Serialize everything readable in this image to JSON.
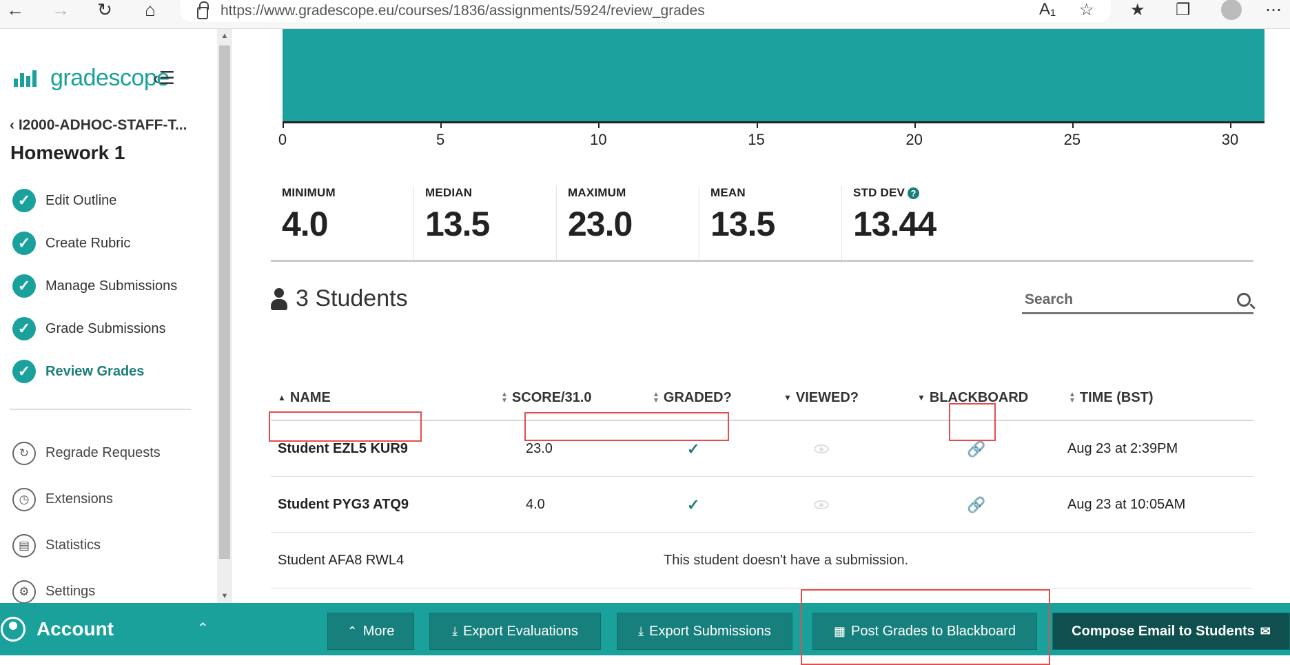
{
  "browser": {
    "url": "https://www.gradescope.eu/courses/1836/assignments/5924/review_grades",
    "icons": [
      "back-arrow",
      "forward-arrow",
      "refresh",
      "home",
      "lock",
      "read-aloud",
      "add-favorite",
      "favorites",
      "collections",
      "profile",
      "more"
    ]
  },
  "sidebar": {
    "brand": "gradescope",
    "course": "I2000-ADHOC-STAFF-T...",
    "assignment": "Homework 1",
    "steps": [
      {
        "label": "Edit Outline"
      },
      {
        "label": "Create Rubric"
      },
      {
        "label": "Manage Submissions"
      },
      {
        "label": "Grade Submissions"
      },
      {
        "label": "Review Grades"
      }
    ],
    "tools": [
      {
        "label": "Regrade Requests",
        "icon": "regrade-icon"
      },
      {
        "label": "Extensions",
        "icon": "clock-icon"
      },
      {
        "label": "Statistics",
        "icon": "chart-icon"
      },
      {
        "label": "Settings",
        "icon": "gear-icon"
      }
    ],
    "account": "Account"
  },
  "histogram": {
    "ticks": [
      "0",
      "5",
      "10",
      "15",
      "20",
      "25",
      "30"
    ]
  },
  "stats": {
    "minimum": {
      "label": "MINIMUM",
      "value": "4.0"
    },
    "median": {
      "label": "MEDIAN",
      "value": "13.5"
    },
    "maximum": {
      "label": "MAXIMUM",
      "value": "23.0"
    },
    "mean": {
      "label": "MEAN",
      "value": "13.5"
    },
    "std_dev": {
      "label": "STD DEV",
      "value": "13.44"
    }
  },
  "students": {
    "title": "3 Students",
    "search_placeholder": "Search",
    "columns": {
      "name": "NAME",
      "score": "SCORE/31.0",
      "graded": "GRADED?",
      "viewed": "VIEWED?",
      "blackboard": "BLACKBOARD",
      "time": "TIME (BST)"
    },
    "rows": [
      {
        "name": "Student EZL5 KUR9",
        "score": "23.0",
        "time": "Aug 23 at 2:39PM"
      },
      {
        "name": "Student PYG3 ATQ9",
        "score": "4.0",
        "time": "Aug 23 at 10:05AM"
      },
      {
        "name": "Student AFA8 RWL4",
        "message": "This student doesn't have a submission."
      }
    ]
  },
  "actions": {
    "more": "More",
    "export_evaluations": "Export Evaluations",
    "export_submissions": "Export Submissions",
    "post_grades": "Post Grades to Blackboard",
    "compose_email": "Compose Email to Students"
  },
  "colors": {
    "brand": "#1aa19c",
    "histogram": "#1da19f",
    "highlight": "#e74c4c"
  }
}
